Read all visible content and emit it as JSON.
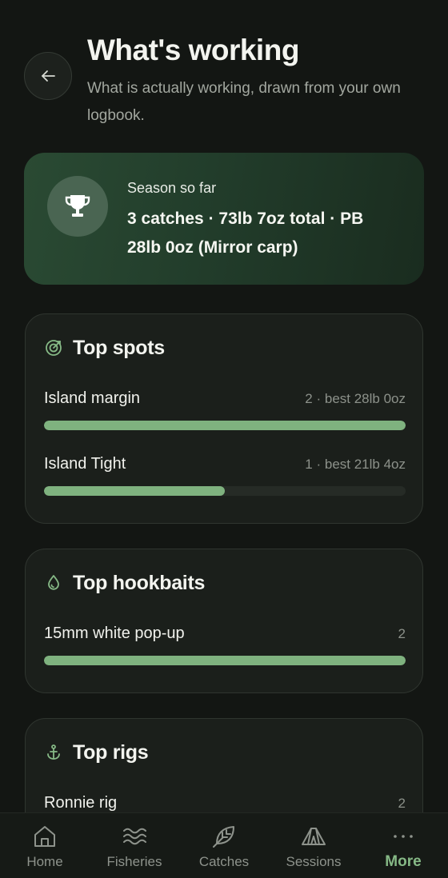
{
  "header": {
    "title": "What's working",
    "subtitle": "What is actually working, drawn from your own logbook."
  },
  "season": {
    "label": "Season so far",
    "summary": "3 catches · 73lb 7oz total · PB 28lb 0oz (Mirror carp)",
    "icon": "trophy-icon"
  },
  "sections": {
    "spots": {
      "title": "Top spots",
      "icon": "target-icon",
      "items": [
        {
          "name": "Island margin",
          "meta": "2 · best 28lb 0oz",
          "fraction": 1.0
        },
        {
          "name": "Island Tight",
          "meta": "1 · best 21lb 4oz",
          "fraction": 0.5
        }
      ]
    },
    "hookbaits": {
      "title": "Top hookbaits",
      "icon": "droplet-icon",
      "items": [
        {
          "name": "15mm white pop-up",
          "meta": "2",
          "fraction": 1.0
        }
      ]
    },
    "rigs": {
      "title": "Top rigs",
      "icon": "anchor-icon",
      "items": [
        {
          "name": "Ronnie rig",
          "meta": "2",
          "fraction": 1.0
        }
      ]
    }
  },
  "nav": {
    "items": [
      {
        "label": "Home",
        "icon": "home-icon"
      },
      {
        "label": "Fisheries",
        "icon": "waves-icon"
      },
      {
        "label": "Catches",
        "icon": "leaf-icon"
      },
      {
        "label": "Sessions",
        "icon": "tent-icon"
      },
      {
        "label": "More",
        "icon": "more-dots-icon"
      }
    ],
    "active_index": 4
  },
  "colors": {
    "accent": "#86b986",
    "bar_fill": "#7fb27f",
    "background": "#131613",
    "card": "#1b1f1b"
  }
}
